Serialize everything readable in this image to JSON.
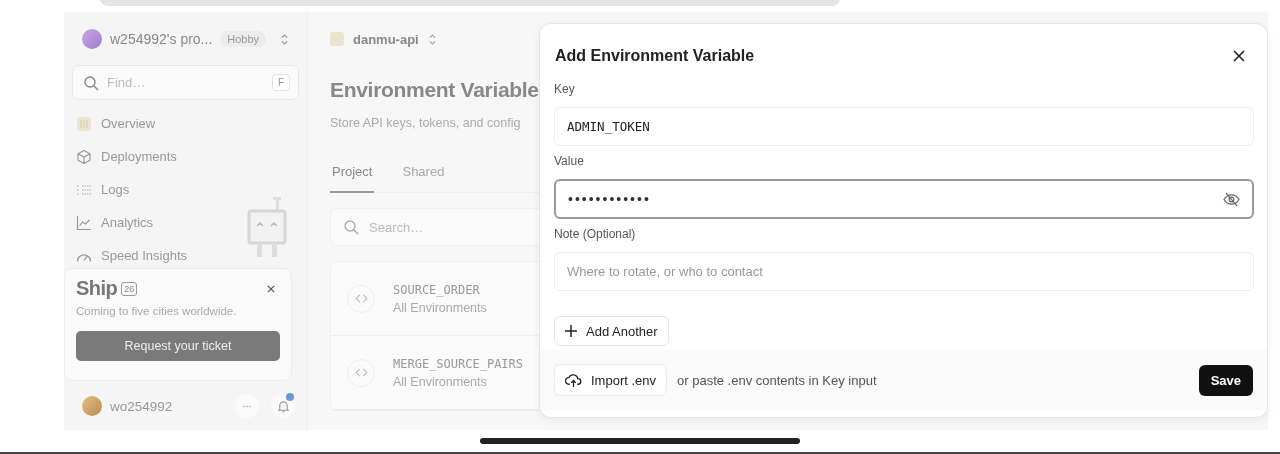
{
  "sidebar": {
    "team": {
      "name": "w254992's pro...",
      "plan": "Hobby"
    },
    "search": {
      "placeholder": "Find…",
      "shortcut": "F"
    },
    "nav": [
      {
        "label": "Overview"
      },
      {
        "label": "Deployments"
      },
      {
        "label": "Logs"
      },
      {
        "label": "Analytics"
      },
      {
        "label": "Speed Insights"
      }
    ],
    "promo": {
      "title": "Ship",
      "badge": "26",
      "text": "Coming to five cities worldwide.",
      "button": "Request your ticket"
    },
    "user": {
      "name": "wo254992",
      "unread": true
    }
  },
  "project": {
    "name": "danmu-api"
  },
  "page": {
    "title": "Environment Variable",
    "subtitle": "Store API keys, tokens, and config"
  },
  "tabs": [
    {
      "label": "Project",
      "selected": true
    },
    {
      "label": "Shared",
      "selected": false
    }
  ],
  "search": {
    "placeholder": "Search…"
  },
  "variables": [
    {
      "name": "SOURCE_ORDER",
      "scope": "All Environments"
    },
    {
      "name": "MERGE_SOURCE_PAIRS",
      "scope": "All Environments"
    }
  ],
  "modal": {
    "title": "Add Environment Variable",
    "fields": [
      {
        "label": "Key",
        "value": "ADMIN_TOKEN",
        "kind": "text",
        "focused": false
      },
      {
        "label": "Value",
        "value": "••••••••••••",
        "kind": "secret",
        "focused": true
      },
      {
        "label": "Note (Optional)",
        "placeholder": "Where to rotate, or who to contact",
        "kind": "note",
        "focused": false
      }
    ],
    "add_button": "Add Another",
    "import_button": "Import .env",
    "import_hint": "or paste .env contents in Key input",
    "save_button": "Save"
  }
}
